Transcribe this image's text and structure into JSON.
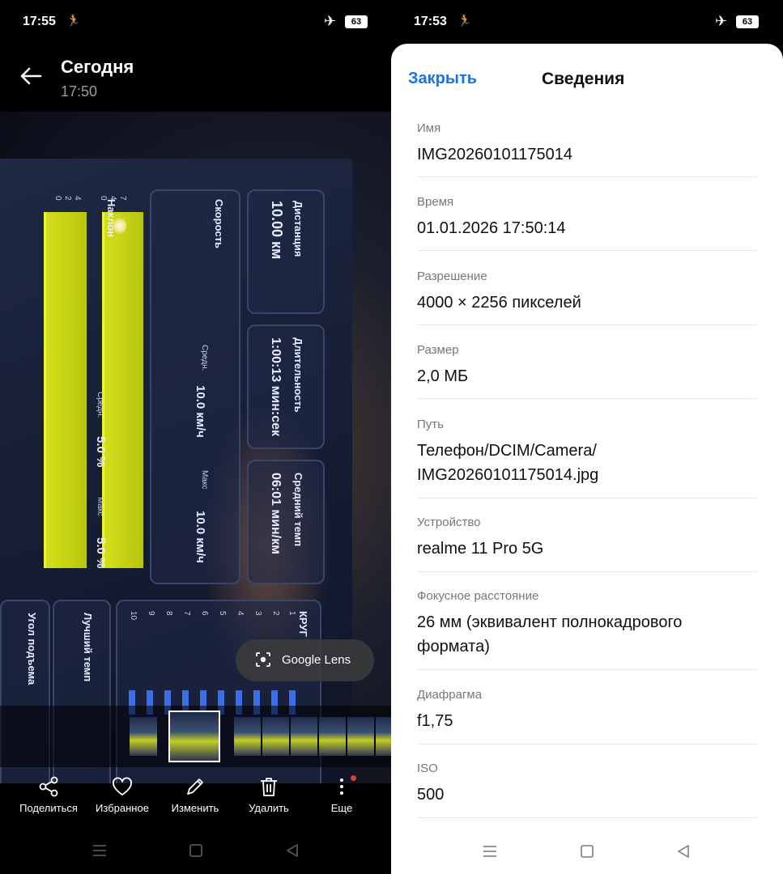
{
  "left": {
    "status": {
      "time": "17:55",
      "battery": "63"
    },
    "header": {
      "title": "Сегодня",
      "subtitle": "17:50"
    },
    "photo": {
      "dashboard": {
        "distance_label": "Дистанция",
        "distance_value": "10.00 км",
        "duration_label": "Длительность",
        "duration_value": "1:00:13 мин:сек",
        "pace_label": "Средний темп",
        "pace_value": "06:01 мин/км",
        "speed_label": "Скорость",
        "speed_avg_label": "Средн.",
        "speed_avg_value": "10.0 км/ч",
        "speed_max_label": "Макс",
        "speed_max_value": "10.0 км/ч",
        "incline_label": "Наклон",
        "incline_avg_label": "Средн.",
        "incline_avg_value": "5.0 %",
        "incline_max_label": "Макс",
        "incline_max_value": "5.0 %",
        "best_pace_label": "Лучший темп",
        "climb_angle_label": "Угол подъема",
        "laps_label": "КРУГ",
        "speed_axis": [
          "7",
          "4",
          "0"
        ],
        "incline_axis": [
          "4",
          "2",
          "0"
        ],
        "lap_numbers": [
          "10",
          "9",
          "8",
          "7",
          "6",
          "5",
          "4",
          "3",
          "2",
          "1"
        ]
      }
    },
    "lens": {
      "label": "Google Lens"
    },
    "toolbar": [
      {
        "label": "Поделиться",
        "icon": "share-icon"
      },
      {
        "label": "Избранное",
        "icon": "heart-icon"
      },
      {
        "label": "Изменить",
        "icon": "pencil-icon"
      },
      {
        "label": "Удалить",
        "icon": "trash-icon"
      },
      {
        "label": "Еще",
        "icon": "more-icon"
      }
    ]
  },
  "right": {
    "status": {
      "time": "17:53",
      "battery": "63"
    },
    "sheet": {
      "close_label": "Закрыть",
      "title": "Сведения",
      "rows": [
        {
          "key": "Имя",
          "value": "IMG20260101175014"
        },
        {
          "key": "Время",
          "value": "01.01.2026 17:50:14"
        },
        {
          "key": "Разрешение",
          "value": "4000 × 2256 пикселей"
        },
        {
          "key": "Размер",
          "value": "2,0 МБ"
        },
        {
          "key": "Путь",
          "value": "Телефон/DCIM/Camera/ IMG20260101175014.jpg"
        },
        {
          "key": "Устройство",
          "value": "realme 11 Pro 5G"
        },
        {
          "key": "Фокусное расстояние",
          "value": "26 мм (эквивалент полнокадрового формата)"
        },
        {
          "key": "Диафрагма",
          "value": "f1,75"
        },
        {
          "key": "ISO",
          "value": "500"
        }
      ]
    }
  },
  "colors": {
    "accent": "#1a73e8",
    "chart_bar": "#d4df1a",
    "notification_dot": "#e53935"
  }
}
